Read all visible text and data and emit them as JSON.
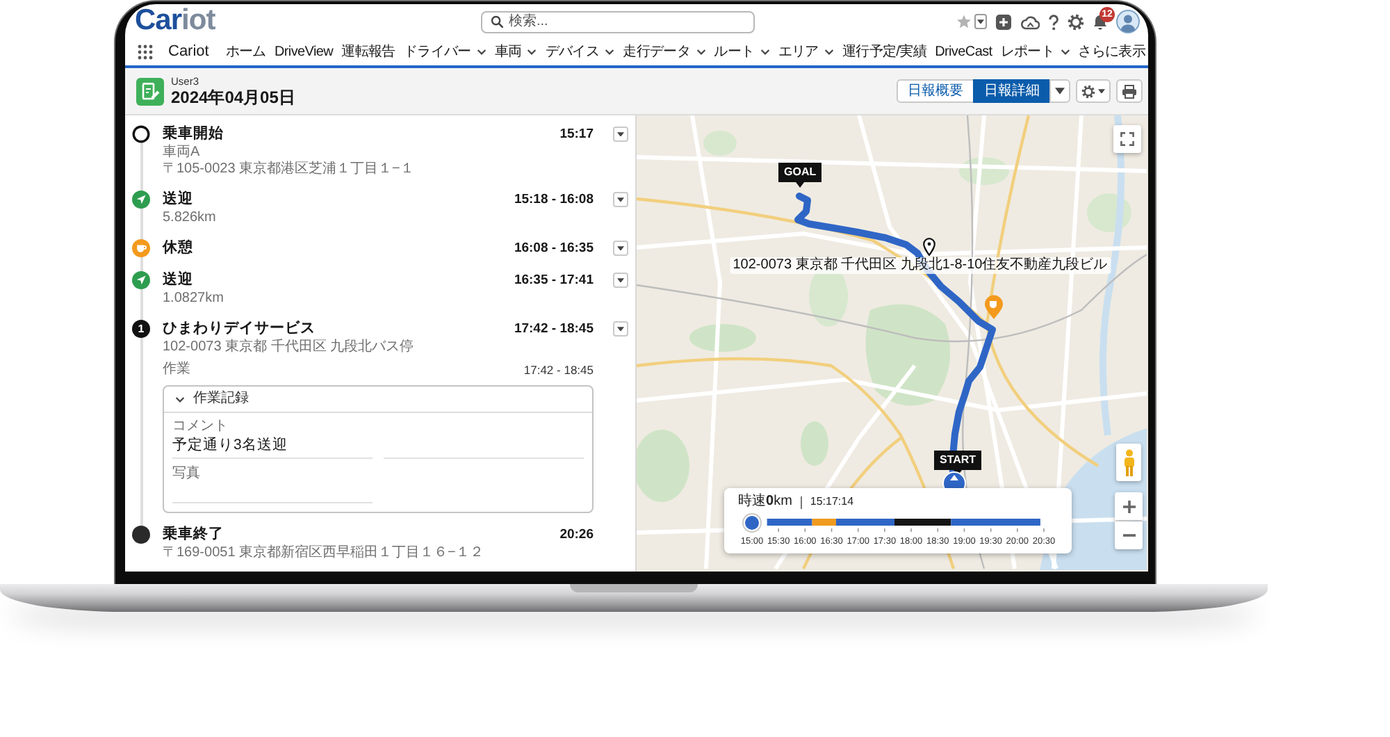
{
  "header": {
    "logo": [
      "Car",
      "iot"
    ],
    "search": {
      "placeholder": "検索..."
    },
    "notification_count": "12"
  },
  "nav": {
    "app_name": "Cariot",
    "items": [
      {
        "label": "ホーム",
        "kind": "link"
      },
      {
        "label": "DriveView",
        "kind": "link"
      },
      {
        "label": "運転報告",
        "kind": "link"
      },
      {
        "label": "ドライバー",
        "kind": "menu"
      },
      {
        "label": "車両",
        "kind": "menu"
      },
      {
        "label": "デバイス",
        "kind": "menu"
      },
      {
        "label": "走行データ",
        "kind": "menu"
      },
      {
        "label": "ルート",
        "kind": "menu"
      },
      {
        "label": "エリア",
        "kind": "menu"
      },
      {
        "label": "運行予定/実績",
        "kind": "link"
      },
      {
        "label": "DriveCast",
        "kind": "link"
      },
      {
        "label": "レポート",
        "kind": "menu"
      },
      {
        "label": "さらに表示",
        "kind": "more"
      }
    ]
  },
  "page_header": {
    "subtitle": "User3",
    "title": "2024年04月05日",
    "views": [
      {
        "label": "日報概要",
        "selected": false
      },
      {
        "label": "日報詳細",
        "selected": true
      }
    ]
  },
  "events": [
    {
      "kind": "start",
      "title": "乗車開始",
      "time": "15:17",
      "lines": [
        "車両A",
        "〒105-0023 東京都港区芝浦１丁目１−１"
      ],
      "menu": true
    },
    {
      "kind": "drive",
      "title": "送迎",
      "time": "15:18 - 16:08",
      "lines": [
        "5.826km"
      ],
      "menu": true
    },
    {
      "kind": "break",
      "title": "休憩",
      "time": "16:08 - 16:35",
      "menu": true
    },
    {
      "kind": "drive",
      "title": "送迎",
      "time": "16:35 - 17:41",
      "lines": [
        "1.0827km"
      ],
      "menu": true
    },
    {
      "kind": "stop",
      "marker": "1",
      "title": "ひまわりデイサービス",
      "time": "17:42 - 18:45",
      "lines": [
        "102-0073 東京都 千代田区 九段北バス停"
      ],
      "menu": true,
      "task": {
        "label": "作業",
        "time": "17:42 - 18:45",
        "record": {
          "title": "作業記録",
          "expanded": true,
          "fields": [
            {
              "label": "コメント",
              "value": "予定通り3名送迎"
            },
            {
              "label": "写真"
            }
          ]
        }
      }
    },
    {
      "kind": "end",
      "title": "乗車終了",
      "time": "20:26",
      "lines": [
        "〒169-0051 東京都新宿区西早稲田１丁目１６−１２"
      ],
      "menu": false
    }
  ],
  "map": {
    "goal": "GOAL",
    "start": "START",
    "address": "102-0073 東京都 千代田区 九段北1-8-10住友不動産九段ビル",
    "playback": {
      "speed": "時速**0**km",
      "time": "15:17:14",
      "level": 0,
      "ticks": [
        "15:00",
        "15:30",
        "16:00",
        "16:30",
        "17:00",
        "17:30",
        "18:00",
        "18:30",
        "19:00",
        "19:30",
        "20:00",
        "20:30"
      ]
    }
  }
}
